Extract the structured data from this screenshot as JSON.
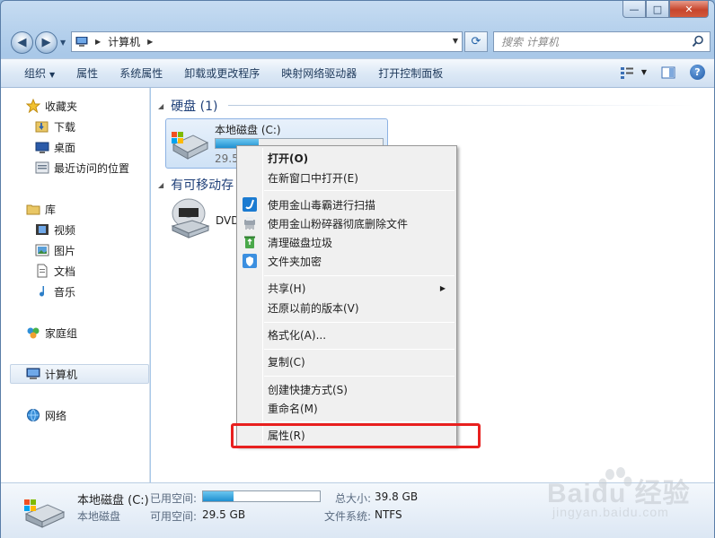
{
  "window": {
    "minimize": "—",
    "maximize": "□",
    "close": "✕"
  },
  "address": {
    "path": [
      "计算机"
    ]
  },
  "search": {
    "placeholder": "搜索 计算机"
  },
  "toolbar": {
    "items": [
      "组织",
      "属性",
      "系统属性",
      "卸载或更改程序",
      "映射网络驱动器",
      "打开控制面板"
    ],
    "help": "?"
  },
  "sidebar": {
    "favorites": {
      "label": "收藏夹",
      "items": [
        "下载",
        "桌面",
        "最近访问的位置"
      ]
    },
    "libraries": {
      "label": "库",
      "items": [
        "视频",
        "图片",
        "文档",
        "音乐"
      ]
    },
    "homegroup": "家庭组",
    "computer": "计算机",
    "network": "网络"
  },
  "main": {
    "hard_disks": {
      "heading": "硬盘 (1)",
      "drive": {
        "name": "本地磁盘 (C:)",
        "free_partial": "29.5",
        "used_fraction": 0.26
      }
    },
    "removable": {
      "heading_partial": "有可移动存",
      "dvd_partial": "DVD"
    }
  },
  "context_menu": {
    "items": [
      {
        "label": "打开(O)",
        "bold": true
      },
      {
        "label": "在新窗口中打开(E)"
      },
      {
        "label": "使用金山毒霸进行扫描",
        "icon": "kingsoft-antivirus-icon"
      },
      {
        "label": "使用金山粉碎器彻底删除文件",
        "icon": "shredder-icon"
      },
      {
        "label": "清理磁盘垃圾",
        "icon": "recycle-clean-icon"
      },
      {
        "label": "文件夹加密",
        "icon": "folder-lock-icon"
      },
      {
        "label": "共享(H)",
        "submenu": true
      },
      {
        "label": "还原以前的版本(V)"
      },
      {
        "label": "格式化(A)..."
      },
      {
        "label": "复制(C)"
      },
      {
        "label": "创建快捷方式(S)"
      },
      {
        "label": "重命名(M)"
      },
      {
        "label": "属性(R)"
      }
    ]
  },
  "details": {
    "name": "本地磁盘 (C:)",
    "type": "本地磁盘",
    "used_label": "已用空间:",
    "free_label": "可用空间:",
    "free_value": "29.5 GB",
    "total_label": "总大小:",
    "total_value": "39.8 GB",
    "fs_label": "文件系统:",
    "fs_value": "NTFS",
    "used_fraction": 0.26
  },
  "watermark": {
    "brand": "Baidu 经验",
    "url": "jingyan.baidu.com"
  },
  "colors": {
    "highlight": "#e8201f",
    "accent": "#1e3f78"
  }
}
